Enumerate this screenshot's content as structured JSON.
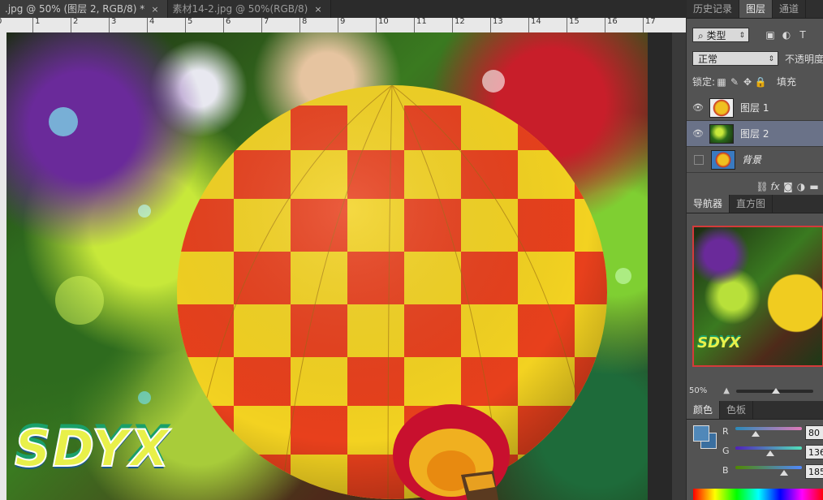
{
  "tabs": [
    {
      "label": ".jpg @ 50% (图层 2, RGB/8) *",
      "close": "×"
    },
    {
      "label": "素材14-2.jpg @ 50%(RGB/8)",
      "close": "×"
    }
  ],
  "ruler": {
    "ticks": [
      "0",
      "1",
      "2",
      "3",
      "4",
      "5",
      "6",
      "7",
      "8",
      "9",
      "10",
      "11",
      "12",
      "13",
      "14",
      "15",
      "16",
      "17"
    ]
  },
  "canvas": {
    "watermark": "SDYX"
  },
  "panel_tabs_top": [
    "历史记录",
    "图层",
    "通道"
  ],
  "layers_panel": {
    "filter_kind": "类型",
    "blend_mode": "正常",
    "opacity_label": "不透明度",
    "lock_label": "锁定:",
    "fill_label": "填充",
    "layers": [
      {
        "name": "图层 1",
        "visible": true,
        "selected": false
      },
      {
        "name": "图层 2",
        "visible": true,
        "selected": true
      },
      {
        "name": "背景",
        "visible": false,
        "selected": false
      }
    ],
    "footer_icons": [
      "link-icon",
      "fx-icon",
      "mask-icon",
      "adjustment-icon",
      "folder-icon"
    ]
  },
  "navigator": {
    "tabs": [
      "导航器",
      "直方图"
    ],
    "zoom": "50%",
    "watermark": "SDYX"
  },
  "color_panel": {
    "tabs": [
      "颜色",
      "色板"
    ],
    "channels": [
      {
        "label": "R",
        "value": "80",
        "level": 0.31
      },
      {
        "label": "G",
        "value": "136",
        "level": 0.53
      },
      {
        "label": "B",
        "value": "185",
        "level": 0.73
      }
    ],
    "foreground": "#5088b9",
    "background": "#3a6fa0"
  },
  "colors": {
    "accent_red": "#d43a3a",
    "selection": "#6a7288"
  }
}
